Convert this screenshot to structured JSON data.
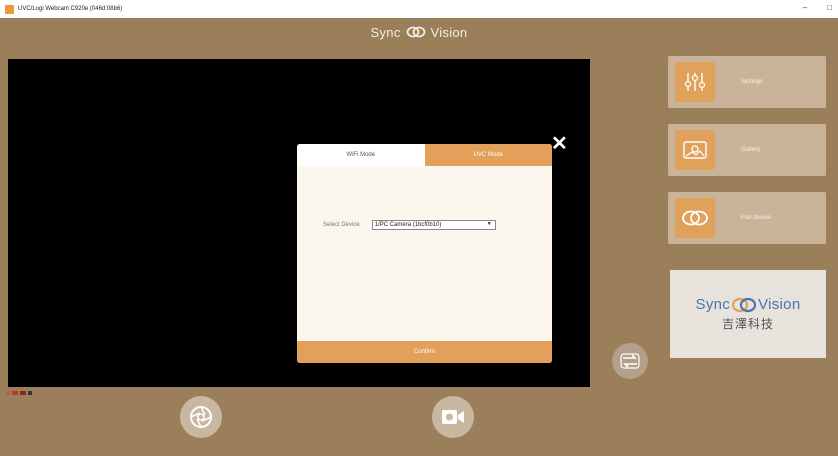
{
  "window": {
    "title": "UVC/Logi Webcam C920e (046d:08b6)",
    "controls": [
      "–",
      "□"
    ]
  },
  "header": {
    "brand_left": "Sync",
    "brand_right": "Vision"
  },
  "sidebar": {
    "settings_label": "Settings",
    "gallery_label": "Gallery",
    "pair_label": "Pair device"
  },
  "brand_box": {
    "left": "Sync",
    "right": "Vision",
    "chinese": "吉澤科技"
  },
  "dialog": {
    "tabs": [
      {
        "label": "WiFi Mode",
        "active": false
      },
      {
        "label": "UVC Mode",
        "active": true
      }
    ],
    "select_label": "Select Device",
    "select_value": "1/PC Camera (1bcf0b10)",
    "confirm_label": "Confirm",
    "close_glyph": "✕"
  },
  "colors": {
    "background": "#9b7f5b",
    "accent": "#e2a05a",
    "brand_blue": "#4b73b2"
  }
}
